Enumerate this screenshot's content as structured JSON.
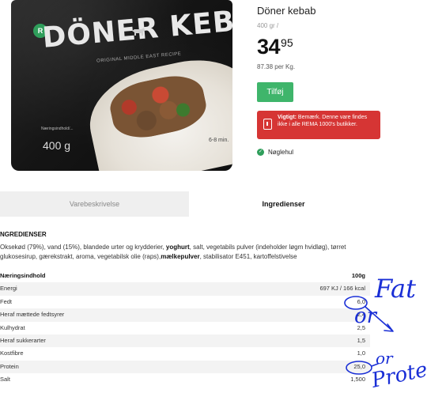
{
  "product": {
    "title": "Döner kebab",
    "weight": "400 gr  /",
    "price_main": "34",
    "price_decimals": "95",
    "unit_price": "87.38 per Kg.",
    "add_button": "Tilføj",
    "alert_label": "Vigtigt:",
    "alert_text": " Bemærk. Denne vare findes ikke i alle REMA 1000's butikker.",
    "keyhole": "Nøglehul"
  },
  "package": {
    "title": "DÖNER KEBAB",
    "subtitle": "ORIGINAL MIDDLE EAST RECIPE",
    "small_text": "Næringsindhold/...",
    "weight": "400 g",
    "minutes": "6-8 min."
  },
  "tabs": [
    {
      "label": "Varebeskrivelse",
      "active": false
    },
    {
      "label": "Ingredienser",
      "active": true
    }
  ],
  "ingredients": {
    "heading": "NGREDIENSER",
    "part1": "Oksekød (79%), vand (15%), blandede urter og krydderier, ",
    "bold1": "yoghurt",
    "part2": ", salt, vegetabils pulver (indeholder løgm hvidløg), tørret glukosesirup, gærekstrakt, aroma, vegetabilsk olie (raps),",
    "bold2": "mælkepulver",
    "part3": ", stabilisator E451, kartoffelstivelse"
  },
  "nutrition": {
    "header_label": "Næringsindhold",
    "header_value": "100g",
    "rows": [
      {
        "label": "Energi",
        "value": "697 KJ / 166 kcal"
      },
      {
        "label": "Fedt",
        "value": "6,0"
      },
      {
        "label": "Heraf mættede fedtsyrer",
        "value": "2,4"
      },
      {
        "label": "Kulhydrat",
        "value": "2,5"
      },
      {
        "label": "Heraf sukkerarter",
        "value": "1,5"
      },
      {
        "label": "Kostfibre",
        "value": "1,0"
      },
      {
        "label": "Protein",
        "value": "25,0"
      },
      {
        "label": "Salt",
        "value": "1,500"
      }
    ]
  },
  "annotations": {
    "fat": "Fat",
    "or_top": "or",
    "or_bottom": "or",
    "protein": "Protein"
  },
  "colors": {
    "accent_green": "#3fb56b",
    "alert_red": "#d63534",
    "annotation_blue": "#1a2fd6"
  }
}
